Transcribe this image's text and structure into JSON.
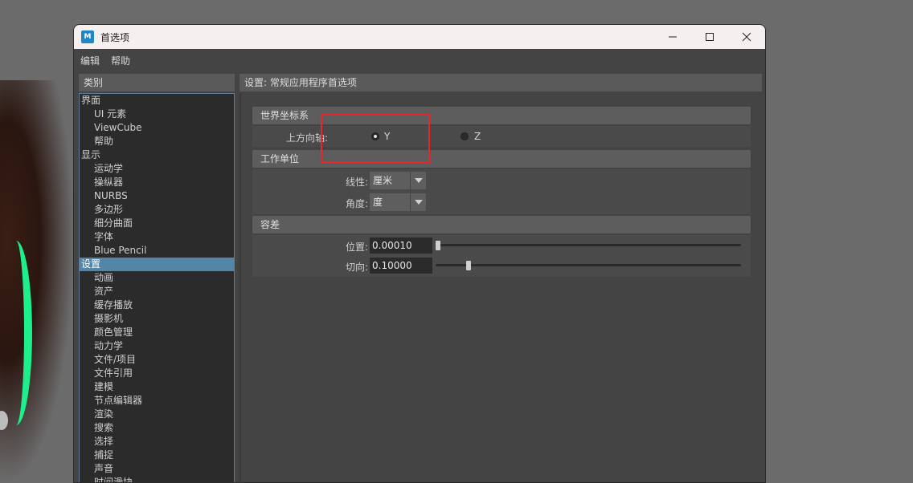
{
  "window": {
    "title": "首选项",
    "app_icon_letter": "M"
  },
  "menu": [
    "编辑",
    "帮助"
  ],
  "categories": {
    "header": "类别",
    "items": [
      {
        "label": "界面",
        "level": "top"
      },
      {
        "label": "UI 元素",
        "level": "sub"
      },
      {
        "label": "ViewCube",
        "level": "sub"
      },
      {
        "label": "帮助",
        "level": "sub"
      },
      {
        "label": "显示",
        "level": "top"
      },
      {
        "label": "运动学",
        "level": "sub"
      },
      {
        "label": "操纵器",
        "level": "sub"
      },
      {
        "label": "NURBS",
        "level": "sub"
      },
      {
        "label": "多边形",
        "level": "sub"
      },
      {
        "label": "细分曲面",
        "level": "sub"
      },
      {
        "label": "字体",
        "level": "sub"
      },
      {
        "label": "Blue Pencil",
        "level": "sub"
      },
      {
        "label": "设置",
        "level": "top",
        "selected": true
      },
      {
        "label": "动画",
        "level": "sub"
      },
      {
        "label": "资产",
        "level": "sub"
      },
      {
        "label": "缓存播放",
        "level": "sub"
      },
      {
        "label": "摄影机",
        "level": "sub"
      },
      {
        "label": "颜色管理",
        "level": "sub"
      },
      {
        "label": "动力学",
        "level": "sub"
      },
      {
        "label": "文件/项目",
        "level": "sub"
      },
      {
        "label": "文件引用",
        "level": "sub"
      },
      {
        "label": "建模",
        "level": "sub"
      },
      {
        "label": "节点编辑器",
        "level": "sub"
      },
      {
        "label": "渲染",
        "level": "sub"
      },
      {
        "label": "搜索",
        "level": "sub"
      },
      {
        "label": "选择",
        "level": "sub"
      },
      {
        "label": "捕捉",
        "level": "sub"
      },
      {
        "label": "声音",
        "level": "sub"
      },
      {
        "label": "时间滑块",
        "level": "sub"
      }
    ]
  },
  "settings": {
    "header": "设置: 常规应用程序首选项",
    "world": {
      "title": "世界坐标系",
      "up_axis_label": "上方向轴:",
      "options": [
        {
          "label": "Y",
          "selected": true
        },
        {
          "label": "Z",
          "selected": false
        }
      ]
    },
    "units": {
      "title": "工作单位",
      "linear_label": "线性:",
      "linear_value": "厘米",
      "angular_label": "角度:",
      "angular_value": "度"
    },
    "tolerance": {
      "title": "容差",
      "position_label": "位置:",
      "position_value": "0.00010",
      "position_slider": 0.0,
      "tangent_label": "切向:",
      "tangent_value": "0.10000",
      "tangent_slider": 0.1
    }
  },
  "colors": {
    "accent_selected": "#5285a6",
    "highlight": "#e5262b"
  }
}
